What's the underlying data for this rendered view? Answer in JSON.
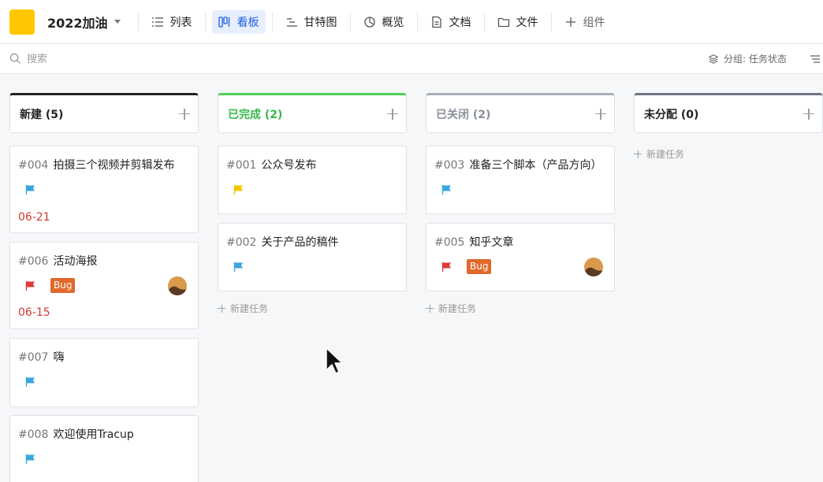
{
  "project": {
    "title": "2022加油"
  },
  "tabs": [
    {
      "label": "列表",
      "icon": "list-icon"
    },
    {
      "label": "看板",
      "icon": "board-icon",
      "active": true
    },
    {
      "label": "甘特图",
      "icon": "gantt-icon"
    },
    {
      "label": "概览",
      "icon": "pie-chart-icon"
    },
    {
      "label": "文档",
      "icon": "document-icon"
    },
    {
      "label": "文件",
      "icon": "folder-icon"
    },
    {
      "label": "组件",
      "icon": "plus-icon"
    }
  ],
  "search": {
    "placeholder": "搜索"
  },
  "group": {
    "label": "分组: 任务状态"
  },
  "add_task_label": "新建任务",
  "colors": {
    "accent": "#1f5fe0",
    "logo": "#ffc800",
    "due_red": "#d2382f",
    "bug_orange": "#e0692b",
    "flag_blue": "#38a6e0",
    "flag_yellow": "#f5c400",
    "flag_red": "#e03a3a"
  },
  "columns": [
    {
      "title": "新建 (5)",
      "accent": "#222222",
      "title_color": "#222222",
      "cards": [
        {
          "number": "#004",
          "title": "拍摄三个视频并剪辑发布",
          "flag": "blue",
          "due": "06-21"
        },
        {
          "number": "#006",
          "title": "活动海报",
          "flag": "red",
          "badge": "Bug",
          "avatar": true,
          "due": "06-15"
        },
        {
          "number": "#007",
          "title": "嗨",
          "flag": "blue"
        },
        {
          "number": "#008",
          "title": "欢迎使用Tracup",
          "flag": "blue"
        }
      ]
    },
    {
      "title": "已完成 (2)",
      "accent": "#52d05a",
      "title_color": "#36b94a",
      "cards": [
        {
          "number": "#001",
          "title": "公众号发布",
          "flag": "yellow"
        },
        {
          "number": "#002",
          "title": "关于产品的稿件",
          "flag": "blue"
        }
      ]
    },
    {
      "title": "已关闭 (2)",
      "accent": "#a9aebb",
      "title_color": "#8a8f99",
      "cards": [
        {
          "number": "#003",
          "title": "准备三个脚本（产品方向）",
          "flag": "blue"
        },
        {
          "number": "#005",
          "title": "知乎文章",
          "flag": "red",
          "badge": "Bug",
          "avatar": true
        }
      ]
    },
    {
      "title": "未分配 (0)",
      "accent": "#6f7687",
      "title_color": "#222222",
      "cards": []
    }
  ]
}
